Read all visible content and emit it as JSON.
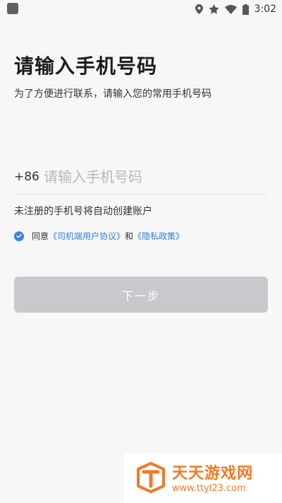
{
  "status_bar": {
    "time": "3:02",
    "icons": [
      "location-icon",
      "star-icon",
      "wifi-icon",
      "battery-icon"
    ]
  },
  "page": {
    "title": "请输入手机号码",
    "subtitle": "为了方便进行联系，请输入您的常用手机号码"
  },
  "phone": {
    "country_code": "+86",
    "placeholder": "请输入手机号码",
    "value": ""
  },
  "hint": "未注册的手机号将自动创建账户",
  "agreement": {
    "checked": true,
    "prefix": "同意",
    "user_agreement": "《司机端用户协议》",
    "connector": "和",
    "privacy_policy": "《隐私政策》"
  },
  "next_button": {
    "label": "下一步",
    "enabled": false
  },
  "watermark": {
    "title": "天天游戏网",
    "url": "www.ttyl23.com"
  },
  "colors": {
    "accent": "#3b82e0",
    "link": "#2f7fd8",
    "button_disabled": "#c8c9cc",
    "watermark": "#f07a28"
  }
}
